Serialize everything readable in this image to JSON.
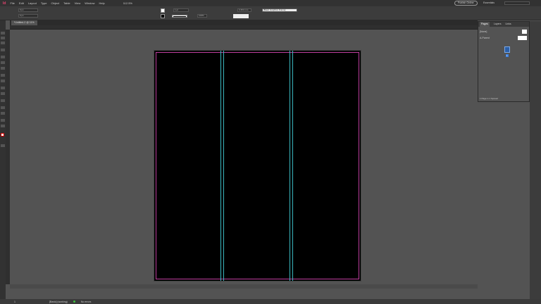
{
  "menu": {
    "logo": "Id",
    "items": [
      "File",
      "Edit",
      "Layout",
      "Type",
      "Object",
      "Table",
      "View",
      "Window",
      "Help"
    ],
    "zoom": "112.5%"
  },
  "header": {
    "publish_label": "Publish Online",
    "workspace": "Essentials"
  },
  "control": {
    "x": "0 px",
    "y": "0 px",
    "stroke_weight": "1 pt",
    "opacity": "100%",
    "gap": "0.353 mm",
    "frame_style": "[Basic Graphics Frame]"
  },
  "document": {
    "tab_title": "*Untitled-2 @ 11%"
  },
  "pages_panel": {
    "tabs": [
      "Pages",
      "Layers",
      "Links"
    ],
    "none_label": "[None]",
    "parent_label": "A-Parent",
    "page_number": "1",
    "footer": "1 Page in 1 Spread"
  },
  "status": {
    "page": "1",
    "preflight_profile": "[Basic] (working)",
    "errors": "No errors",
    "status_color": "#3fbf3f"
  },
  "colors": {
    "margin": "#c03fa0",
    "column_guide": "#3bb8c0",
    "page": "#000000"
  }
}
